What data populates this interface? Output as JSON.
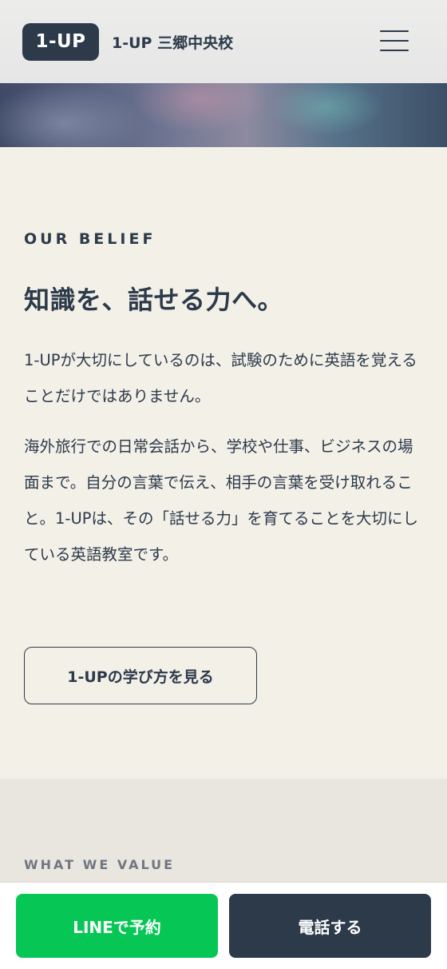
{
  "header": {
    "logo_text": "1-UP",
    "site_name": "1-UP 三郷中央校",
    "menu_icon": "hamburger-menu-icon"
  },
  "belief": {
    "eyebrow": "OUR BELIEF",
    "headline": "知識を、話せる力へ。",
    "paragraph1": "1-UPが大切にしているのは、試験のために英語を覚えることだけではありません。",
    "paragraph2": "海外旅行での日常会話から、学校や仕事、ビジネスの場面まで。自分の言葉で伝え、相手の言葉を受け取れること。1-UPは、その「話せる力」を育てることを大切にしている英語教室です。",
    "cta_label": "1-UPの学び方を見る"
  },
  "values": {
    "eyebrow": "WHAT WE VALUE"
  },
  "bottom_bar": {
    "line_label": "LINEで予約",
    "tel_label": "電話する"
  },
  "colors": {
    "navy": "#2c3a4a",
    "line_green": "#06c755",
    "background": "#f3f0e8"
  }
}
